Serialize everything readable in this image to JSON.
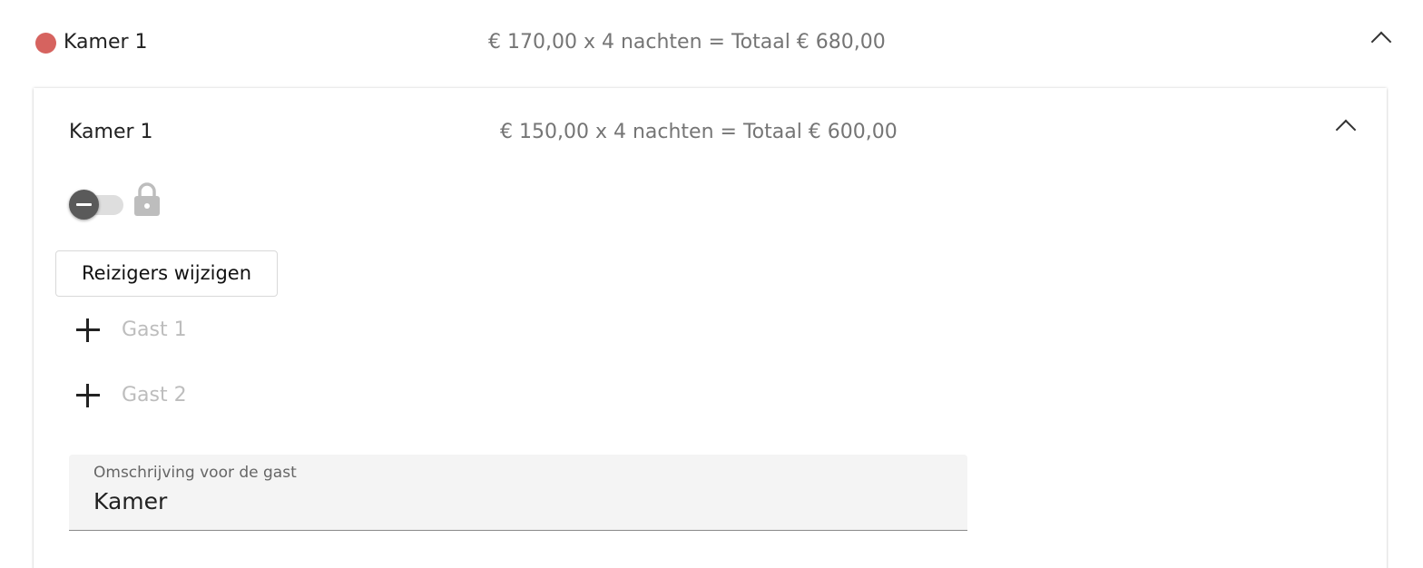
{
  "room": {
    "title": "Kamer 1",
    "price_summary": "€ 170,00 x 4 nachten = Totaal € 680,00",
    "status_color": "#d6635f",
    "collapse_icon": "chevron-up-icon"
  },
  "card": {
    "title": "Kamer 1",
    "price_summary": "€ 150,00 x 4 nachten = Totaal € 600,00",
    "collapse_icon": "chevron-up-icon",
    "toggle": {
      "state": "off",
      "icon": "lock-icon"
    },
    "edit_travelers_label": "Reizigers wijzigen",
    "guests": [
      {
        "label": "Gast 1",
        "icon": "plus-icon"
      },
      {
        "label": "Gast 2",
        "icon": "plus-icon"
      }
    ],
    "description_field": {
      "label": "Omschrijving voor de gast",
      "value": "Kamer"
    }
  }
}
